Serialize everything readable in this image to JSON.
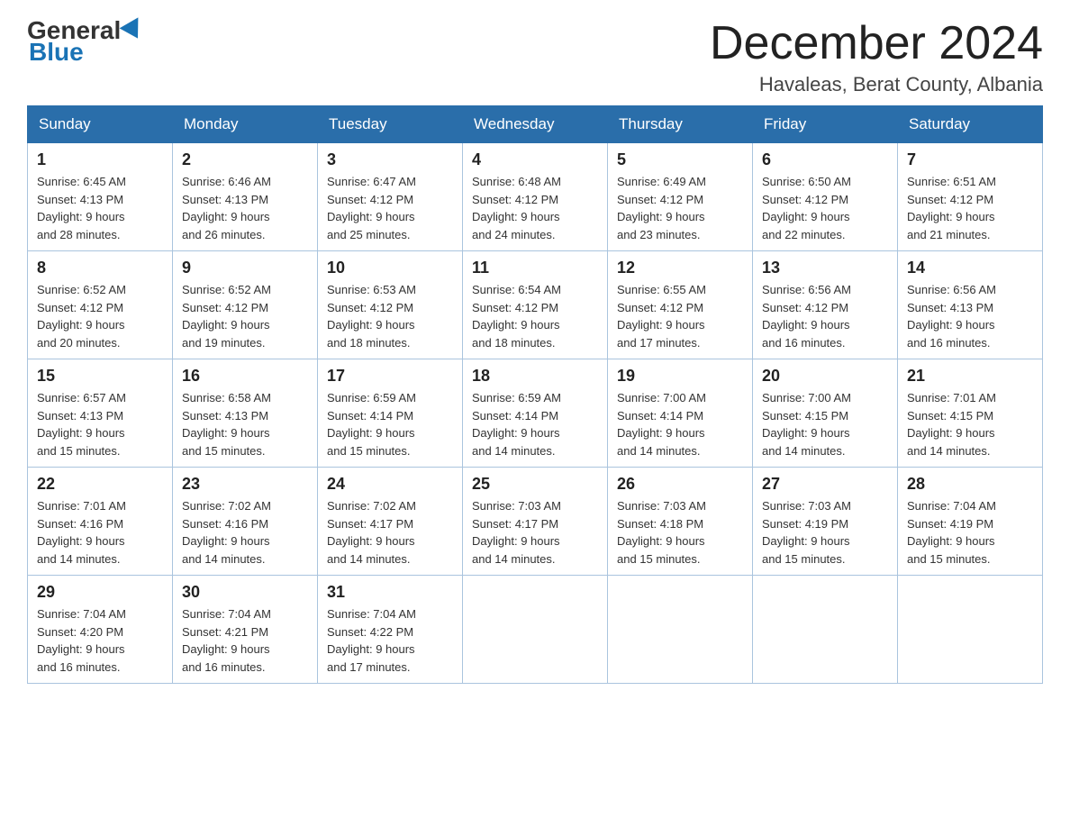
{
  "logo": {
    "general": "General",
    "blue": "Blue"
  },
  "title": "December 2024",
  "location": "Havaleas, Berat County, Albania",
  "days_of_week": [
    "Sunday",
    "Monday",
    "Tuesday",
    "Wednesday",
    "Thursday",
    "Friday",
    "Saturday"
  ],
  "weeks": [
    [
      {
        "day": "1",
        "sunrise": "6:45 AM",
        "sunset": "4:13 PM",
        "daylight": "9 hours and 28 minutes."
      },
      {
        "day": "2",
        "sunrise": "6:46 AM",
        "sunset": "4:13 PM",
        "daylight": "9 hours and 26 minutes."
      },
      {
        "day": "3",
        "sunrise": "6:47 AM",
        "sunset": "4:12 PM",
        "daylight": "9 hours and 25 minutes."
      },
      {
        "day": "4",
        "sunrise": "6:48 AM",
        "sunset": "4:12 PM",
        "daylight": "9 hours and 24 minutes."
      },
      {
        "day": "5",
        "sunrise": "6:49 AM",
        "sunset": "4:12 PM",
        "daylight": "9 hours and 23 minutes."
      },
      {
        "day": "6",
        "sunrise": "6:50 AM",
        "sunset": "4:12 PM",
        "daylight": "9 hours and 22 minutes."
      },
      {
        "day": "7",
        "sunrise": "6:51 AM",
        "sunset": "4:12 PM",
        "daylight": "9 hours and 21 minutes."
      }
    ],
    [
      {
        "day": "8",
        "sunrise": "6:52 AM",
        "sunset": "4:12 PM",
        "daylight": "9 hours and 20 minutes."
      },
      {
        "day": "9",
        "sunrise": "6:52 AM",
        "sunset": "4:12 PM",
        "daylight": "9 hours and 19 minutes."
      },
      {
        "day": "10",
        "sunrise": "6:53 AM",
        "sunset": "4:12 PM",
        "daylight": "9 hours and 18 minutes."
      },
      {
        "day": "11",
        "sunrise": "6:54 AM",
        "sunset": "4:12 PM",
        "daylight": "9 hours and 18 minutes."
      },
      {
        "day": "12",
        "sunrise": "6:55 AM",
        "sunset": "4:12 PM",
        "daylight": "9 hours and 17 minutes."
      },
      {
        "day": "13",
        "sunrise": "6:56 AM",
        "sunset": "4:12 PM",
        "daylight": "9 hours and 16 minutes."
      },
      {
        "day": "14",
        "sunrise": "6:56 AM",
        "sunset": "4:13 PM",
        "daylight": "9 hours and 16 minutes."
      }
    ],
    [
      {
        "day": "15",
        "sunrise": "6:57 AM",
        "sunset": "4:13 PM",
        "daylight": "9 hours and 15 minutes."
      },
      {
        "day": "16",
        "sunrise": "6:58 AM",
        "sunset": "4:13 PM",
        "daylight": "9 hours and 15 minutes."
      },
      {
        "day": "17",
        "sunrise": "6:59 AM",
        "sunset": "4:14 PM",
        "daylight": "9 hours and 15 minutes."
      },
      {
        "day": "18",
        "sunrise": "6:59 AM",
        "sunset": "4:14 PM",
        "daylight": "9 hours and 14 minutes."
      },
      {
        "day": "19",
        "sunrise": "7:00 AM",
        "sunset": "4:14 PM",
        "daylight": "9 hours and 14 minutes."
      },
      {
        "day": "20",
        "sunrise": "7:00 AM",
        "sunset": "4:15 PM",
        "daylight": "9 hours and 14 minutes."
      },
      {
        "day": "21",
        "sunrise": "7:01 AM",
        "sunset": "4:15 PM",
        "daylight": "9 hours and 14 minutes."
      }
    ],
    [
      {
        "day": "22",
        "sunrise": "7:01 AM",
        "sunset": "4:16 PM",
        "daylight": "9 hours and 14 minutes."
      },
      {
        "day": "23",
        "sunrise": "7:02 AM",
        "sunset": "4:16 PM",
        "daylight": "9 hours and 14 minutes."
      },
      {
        "day": "24",
        "sunrise": "7:02 AM",
        "sunset": "4:17 PM",
        "daylight": "9 hours and 14 minutes."
      },
      {
        "day": "25",
        "sunrise": "7:03 AM",
        "sunset": "4:17 PM",
        "daylight": "9 hours and 14 minutes."
      },
      {
        "day": "26",
        "sunrise": "7:03 AM",
        "sunset": "4:18 PM",
        "daylight": "9 hours and 15 minutes."
      },
      {
        "day": "27",
        "sunrise": "7:03 AM",
        "sunset": "4:19 PM",
        "daylight": "9 hours and 15 minutes."
      },
      {
        "day": "28",
        "sunrise": "7:04 AM",
        "sunset": "4:19 PM",
        "daylight": "9 hours and 15 minutes."
      }
    ],
    [
      {
        "day": "29",
        "sunrise": "7:04 AM",
        "sunset": "4:20 PM",
        "daylight": "9 hours and 16 minutes."
      },
      {
        "day": "30",
        "sunrise": "7:04 AM",
        "sunset": "4:21 PM",
        "daylight": "9 hours and 16 minutes."
      },
      {
        "day": "31",
        "sunrise": "7:04 AM",
        "sunset": "4:22 PM",
        "daylight": "9 hours and 17 minutes."
      },
      null,
      null,
      null,
      null
    ]
  ],
  "labels": {
    "sunrise": "Sunrise:",
    "sunset": "Sunset:",
    "daylight": "Daylight:"
  }
}
